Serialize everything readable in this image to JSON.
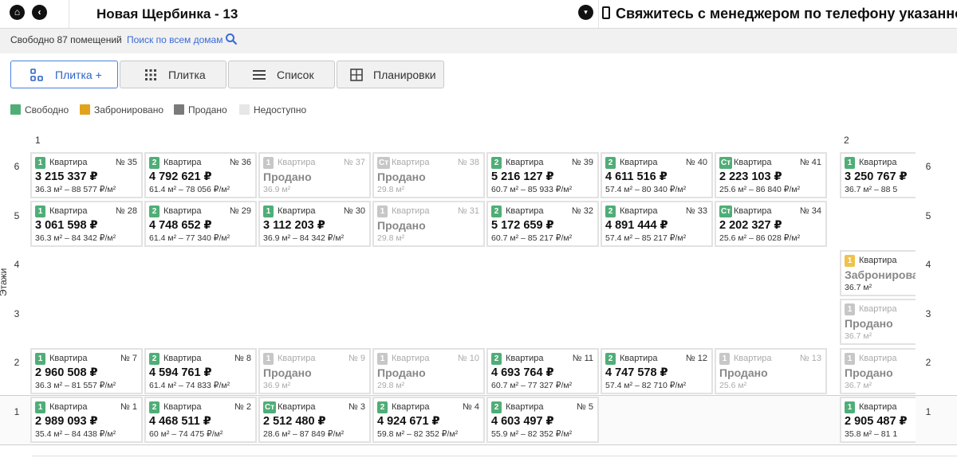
{
  "header": {
    "house_title": "Новая Щербинка - 13",
    "contact_text": "Свяжитесь с менеджером по телефону указанном"
  },
  "info": {
    "free_count": "Свободно 87 помещений",
    "search_link": "Поиск по всем домам"
  },
  "tabs": [
    {
      "label": "Плитка +",
      "icon": "tile-plus-icon",
      "active": true
    },
    {
      "label": "Плитка",
      "icon": "grid-dots-icon",
      "active": false
    },
    {
      "label": "Список",
      "icon": "list-icon",
      "active": false
    },
    {
      "label": "Планировки",
      "icon": "layout-icon",
      "active": false
    }
  ],
  "legend": [
    {
      "label": "Свободно",
      "color": "#4fae77"
    },
    {
      "label": "Забронировано",
      "color": "#e2a31c"
    },
    {
      "label": "Продано",
      "color": "#7a7a7a"
    },
    {
      "label": "Недоступно",
      "color": "#e6e6e6"
    }
  ],
  "sections": [
    "1",
    "2"
  ],
  "floors": [
    "6",
    "5",
    "4",
    "3",
    "2",
    "1"
  ],
  "floors_axis_label": "Этажи",
  "apartments": [
    {
      "floor": "6",
      "col": 0,
      "rooms": "1",
      "kind": "Квартира",
      "num": "№ 35",
      "status": "free",
      "price": "3 215 337 ₽",
      "detail": "36.3 м² – 88 577 ₽/м²"
    },
    {
      "floor": "6",
      "col": 1,
      "rooms": "2",
      "kind": "Квартира",
      "num": "№ 36",
      "status": "free",
      "price": "4 792 621 ₽",
      "detail": "61.4 м² – 78 056 ₽/м²"
    },
    {
      "floor": "6",
      "col": 2,
      "rooms": "1",
      "kind": "Квартира",
      "num": "№ 37",
      "status": "sold",
      "price": "Продано",
      "detail": "36.9 м²"
    },
    {
      "floor": "6",
      "col": 3,
      "rooms": "Ст",
      "kind": "Квартира",
      "num": "№ 38",
      "status": "sold",
      "price": "Продано",
      "detail": "29.8 м²"
    },
    {
      "floor": "6",
      "col": 4,
      "rooms": "2",
      "kind": "Квартира",
      "num": "№ 39",
      "status": "free",
      "price": "5 216 127 ₽",
      "detail": "60.7 м² – 85 933 ₽/м²"
    },
    {
      "floor": "6",
      "col": 5,
      "rooms": "2",
      "kind": "Квартира",
      "num": "№ 40",
      "status": "free",
      "price": "4 611 516 ₽",
      "detail": "57.4 м² – 80 340 ₽/м²"
    },
    {
      "floor": "6",
      "col": 6,
      "rooms": "Ст",
      "kind": "Квартира",
      "num": "№ 41",
      "status": "free",
      "price": "2 223 103 ₽",
      "detail": "25.6 м² – 86 840 ₽/м²"
    },
    {
      "floor": "6",
      "col": 7,
      "rooms": "1",
      "kind": "Квартира",
      "num": "",
      "status": "free",
      "price": "3 250 767 ₽",
      "detail": "36.7 м² – 88 5",
      "clipped": true
    },
    {
      "floor": "5",
      "col": 0,
      "rooms": "1",
      "kind": "Квартира",
      "num": "№ 28",
      "status": "free",
      "price": "3 061 598 ₽",
      "detail": "36.3 м² – 84 342 ₽/м²"
    },
    {
      "floor": "5",
      "col": 1,
      "rooms": "2",
      "kind": "Квартира",
      "num": "№ 29",
      "status": "free",
      "price": "4 748 652 ₽",
      "detail": "61.4 м² – 77 340 ₽/м²"
    },
    {
      "floor": "5",
      "col": 2,
      "rooms": "1",
      "kind": "Квартира",
      "num": "№ 30",
      "status": "free",
      "price": "3 112 203 ₽",
      "detail": "36.9 м² – 84 342 ₽/м²"
    },
    {
      "floor": "5",
      "col": 3,
      "rooms": "1",
      "kind": "Квартира",
      "num": "№ 31",
      "status": "sold",
      "price": "Продано",
      "detail": "29.8 м²"
    },
    {
      "floor": "5",
      "col": 4,
      "rooms": "2",
      "kind": "Квартира",
      "num": "№ 32",
      "status": "free",
      "price": "5 172 659 ₽",
      "detail": "60.7 м² – 85 217 ₽/м²"
    },
    {
      "floor": "5",
      "col": 5,
      "rooms": "2",
      "kind": "Квартира",
      "num": "№ 33",
      "status": "free",
      "price": "4 891 444 ₽",
      "detail": "57.4 м² – 85 217 ₽/м²"
    },
    {
      "floor": "5",
      "col": 6,
      "rooms": "Ст",
      "kind": "Квартира",
      "num": "№ 34",
      "status": "free",
      "price": "2 202 327 ₽",
      "detail": "25.6 м² – 86 028 ₽/м²"
    },
    {
      "floor": "4",
      "col": 7,
      "rooms": "1",
      "kind": "Квартира",
      "num": "",
      "status": "reserved",
      "price": "Забронирова",
      "detail": "36.7 м²",
      "clipped": true
    },
    {
      "floor": "3",
      "col": 7,
      "rooms": "1",
      "kind": "Квартира",
      "num": "",
      "status": "sold",
      "price": "Продано",
      "detail": "36.7 м²",
      "clipped": true
    },
    {
      "floor": "2",
      "col": 0,
      "rooms": "1",
      "kind": "Квартира",
      "num": "№ 7",
      "status": "free",
      "price": "2 960 508 ₽",
      "detail": "36.3 м² – 81 557 ₽/м²"
    },
    {
      "floor": "2",
      "col": 1,
      "rooms": "2",
      "kind": "Квартира",
      "num": "№ 8",
      "status": "free",
      "price": "4 594 761 ₽",
      "detail": "61.4 м² – 74 833 ₽/м²"
    },
    {
      "floor": "2",
      "col": 2,
      "rooms": "1",
      "kind": "Квартира",
      "num": "№ 9",
      "status": "sold",
      "price": "Продано",
      "detail": "36.9 м²"
    },
    {
      "floor": "2",
      "col": 3,
      "rooms": "1",
      "kind": "Квартира",
      "num": "№ 10",
      "status": "sold",
      "price": "Продано",
      "detail": "29.8 м²"
    },
    {
      "floor": "2",
      "col": 4,
      "rooms": "2",
      "kind": "Квартира",
      "num": "№ 11",
      "status": "free",
      "price": "4 693 764 ₽",
      "detail": "60.7 м² – 77 327 ₽/м²"
    },
    {
      "floor": "2",
      "col": 5,
      "rooms": "2",
      "kind": "Квартира",
      "num": "№ 12",
      "status": "free",
      "price": "4 747 578 ₽",
      "detail": "57.4 м² – 82 710 ₽/м²"
    },
    {
      "floor": "2",
      "col": 6,
      "rooms": "1",
      "kind": "Квартира",
      "num": "№ 13",
      "status": "sold",
      "price": "Продано",
      "detail": "25.6 м²"
    },
    {
      "floor": "2",
      "col": 7,
      "rooms": "1",
      "kind": "Квартира",
      "num": "",
      "status": "sold",
      "price": "Продано",
      "detail": "36.7 м²",
      "clipped": true
    },
    {
      "floor": "1",
      "col": 0,
      "rooms": "1",
      "kind": "Квартира",
      "num": "№ 1",
      "status": "free",
      "price": "2 989 093 ₽",
      "detail": "35.4 м² – 84 438 ₽/м²"
    },
    {
      "floor": "1",
      "col": 1,
      "rooms": "2",
      "kind": "Квартира",
      "num": "№ 2",
      "status": "free",
      "price": "4 468 511 ₽",
      "detail": "60 м² – 74 475 ₽/м²"
    },
    {
      "floor": "1",
      "col": 2,
      "rooms": "Ст",
      "kind": "Квартира",
      "num": "№ 3",
      "status": "free",
      "price": "2 512 480 ₽",
      "detail": "28.6 м² – 87 849 ₽/м²"
    },
    {
      "floor": "1",
      "col": 3,
      "rooms": "2",
      "kind": "Квартира",
      "num": "№ 4",
      "status": "free",
      "price": "4 924 671 ₽",
      "detail": "59.8 м² – 82 352 ₽/м²"
    },
    {
      "floor": "1",
      "col": 4,
      "rooms": "2",
      "kind": "Квартира",
      "num": "№ 5",
      "status": "free",
      "price": "4 603 497 ₽",
      "detail": "55.9 м² – 82 352 ₽/м²"
    },
    {
      "floor": "1",
      "col": 7,
      "rooms": "1",
      "kind": "Квартира",
      "num": "",
      "status": "free",
      "price": "2 905 487 ₽",
      "detail": "35.8 м² – 81 1",
      "clipped": true
    }
  ]
}
